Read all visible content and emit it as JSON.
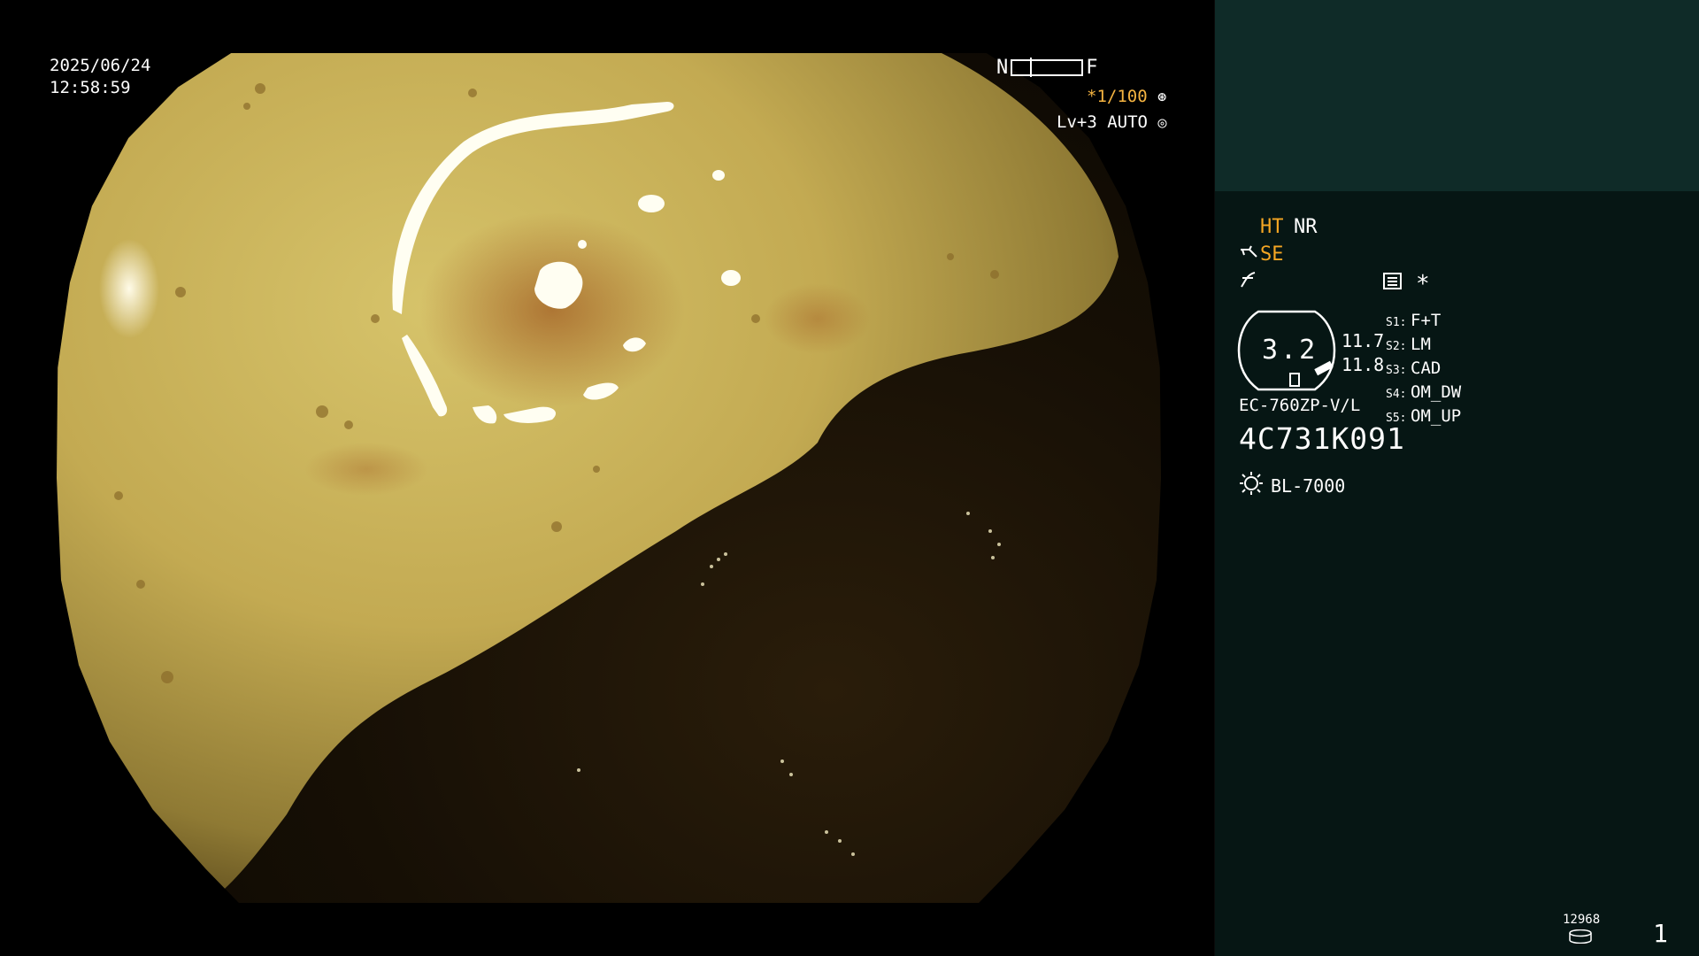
{
  "overlay": {
    "date": "2025/06/24",
    "time": "12:58:59",
    "nf_left": "N",
    "nf_right": "F",
    "shutter": "*1/100",
    "level": "Lv+3 AUTO"
  },
  "panel": {
    "mode1": "HT",
    "mode2": "NR",
    "enh": "SE",
    "star": "*",
    "zoom": "3.2",
    "side_val1": "11.7",
    "side_val2": "11.8",
    "switches": [
      {
        "key": "S1:",
        "val": "F+T"
      },
      {
        "key": "S2:",
        "val": "LM"
      },
      {
        "key": "S3:",
        "val": "CAD"
      },
      {
        "key": "S4:",
        "val": "OM_DW"
      },
      {
        "key": "S5:",
        "val": "OM_UP"
      }
    ],
    "model": "EC-760ZP-V/L",
    "serial": "4C731K091",
    "lamp": "BL-7000",
    "counter": "12968",
    "page": "1"
  },
  "colors": {
    "accent": "#f5a623",
    "panel_top": "#0f2b28",
    "panel_main": "#061614",
    "mucosa": "#c8b860"
  },
  "icons": [
    "aperture-icon",
    "iris-icon",
    "scope-icon",
    "curve-icon",
    "menu-icon",
    "lamp-icon",
    "disk-icon"
  ]
}
